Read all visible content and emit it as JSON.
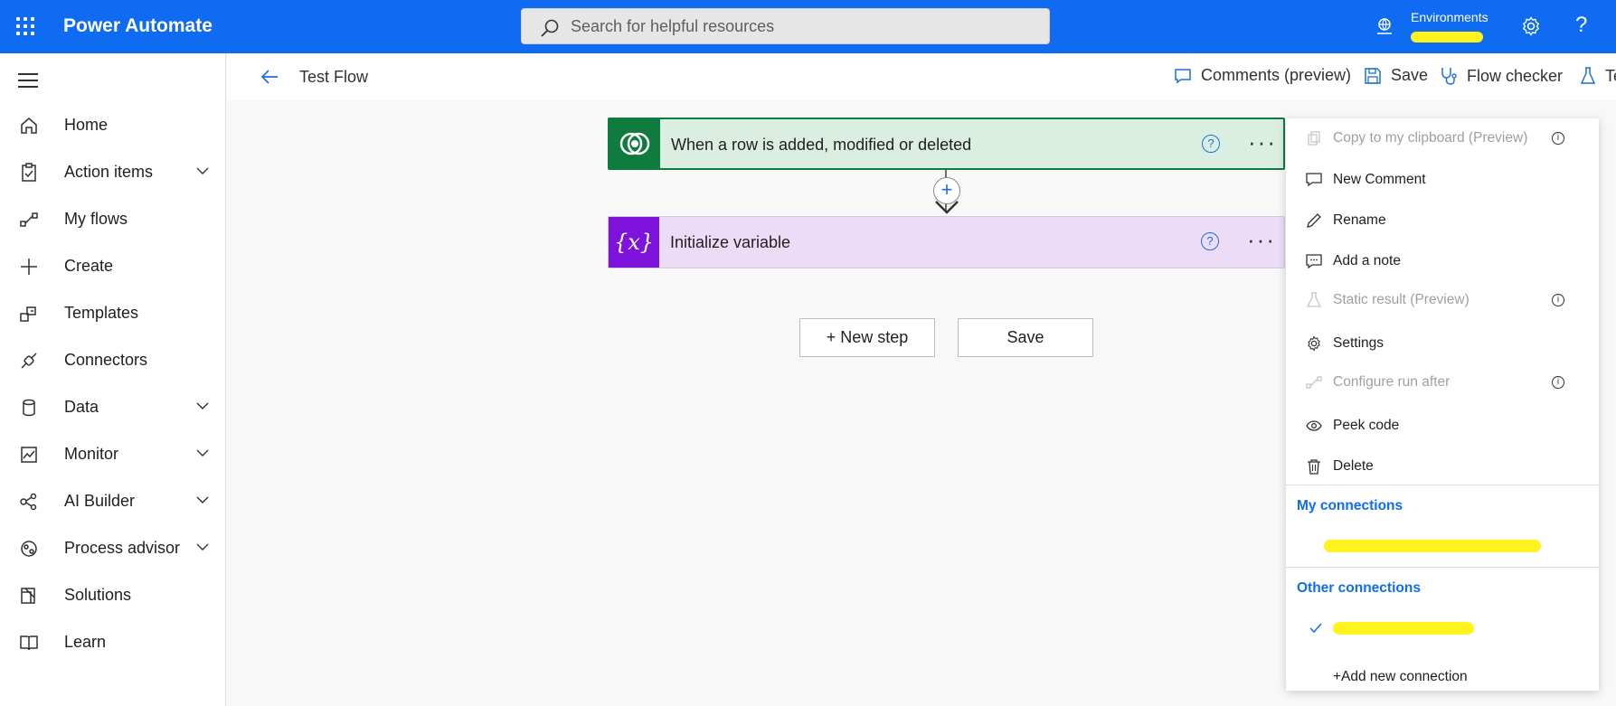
{
  "topbar": {
    "app_title": "Power Automate",
    "search_placeholder": "Search for helpful resources",
    "environments_label": "Environments",
    "help_glyph": "?"
  },
  "sidebar": {
    "items": [
      {
        "label": "Home",
        "icon": "home-icon",
        "expandable": false
      },
      {
        "label": "Action items",
        "icon": "clipboard-icon",
        "expandable": true
      },
      {
        "label": "My flows",
        "icon": "flow-icon",
        "expandable": false
      },
      {
        "label": "Create",
        "icon": "plus-icon",
        "expandable": false
      },
      {
        "label": "Templates",
        "icon": "templates-icon",
        "expandable": false
      },
      {
        "label": "Connectors",
        "icon": "connectors-icon",
        "expandable": false
      },
      {
        "label": "Data",
        "icon": "database-icon",
        "expandable": true
      },
      {
        "label": "Monitor",
        "icon": "monitor-icon",
        "expandable": true
      },
      {
        "label": "AI Builder",
        "icon": "ai-builder-icon",
        "expandable": true
      },
      {
        "label": "Process advisor",
        "icon": "process-advisor-icon",
        "expandable": true
      },
      {
        "label": "Solutions",
        "icon": "solutions-icon",
        "expandable": false
      },
      {
        "label": "Learn",
        "icon": "book-icon",
        "expandable": false
      }
    ]
  },
  "cmdbar": {
    "flow_title": "Test Flow",
    "comments": "Comments (preview)",
    "save": "Save",
    "flow_checker": "Flow checker",
    "test": "Te"
  },
  "canvas": {
    "trigger_title": "When a row is added, modified or deleted",
    "action_title": "Initialize variable",
    "action_icon_text": "{x}",
    "help_glyph": "?",
    "more_glyph": "···",
    "plus_glyph": "+",
    "new_step": "+ New step",
    "save": "Save"
  },
  "menu": {
    "copy": "Copy to my clipboard (Preview)",
    "new_comment": "New Comment",
    "rename": "Rename",
    "add_note": "Add a note",
    "static_result": "Static result (Preview)",
    "settings": "Settings",
    "configure_run_after": "Configure run after",
    "peek_code": "Peek code",
    "delete": "Delete",
    "my_connections": "My connections",
    "other_connections": "Other connections",
    "add_connection": "+Add new connection",
    "info_glyph": "i"
  },
  "colors": {
    "brand_blue": "#0f6cf2",
    "trigger_green": "#0f7b3f",
    "variable_purple": "#7e14dc",
    "redaction_yellow": "#fff21d"
  }
}
